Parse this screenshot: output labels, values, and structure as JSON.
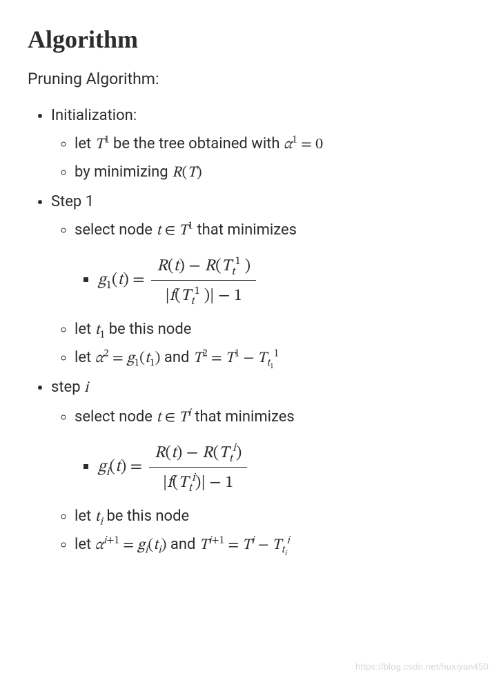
{
  "heading": "Algorithm",
  "subtitle": "Pruning Algorithm:",
  "items": {
    "init_label": "Initialization:",
    "init_a_pre": "let ",
    "init_a_mid": " be the tree obtained with ",
    "init_b_pre": "by minimizing ",
    "step1_label": "Step 1",
    "step1_a_pre": "select node ",
    "step1_a_post": " that minimizes",
    "step1_c_pre": "let ",
    "step1_c_post": " be this node",
    "step1_d_pre": "let ",
    "step1_d_and": " and ",
    "stepi_label_pre": "step ",
    "stepi_a_pre": "select node ",
    "stepi_a_post": " that minimizes",
    "stepi_c_pre": "let ",
    "stepi_c_post": " be this node",
    "stepi_d_pre": "let ",
    "stepi_d_and": " and "
  },
  "math": {
    "T": "T",
    "R": "R",
    "t": "t",
    "g": "g",
    "f": "f",
    "alpha": "α",
    "i": "i",
    "in": "∈",
    "eq": "=",
    "minus": "−",
    "plus1": "+1",
    "zero": "0",
    "one": "1",
    "two": "2",
    "lp": "(",
    "rp": ")",
    "bar": "|",
    "sup1": "1",
    "sup2": "2",
    "supi": "i",
    "sub1": "1",
    "subi": "i",
    "subt": "t",
    "subt1": "t1",
    "subti": "ti",
    "supi1": "i+1"
  },
  "watermark": "https://blog.csdn.net/huxiyan450"
}
